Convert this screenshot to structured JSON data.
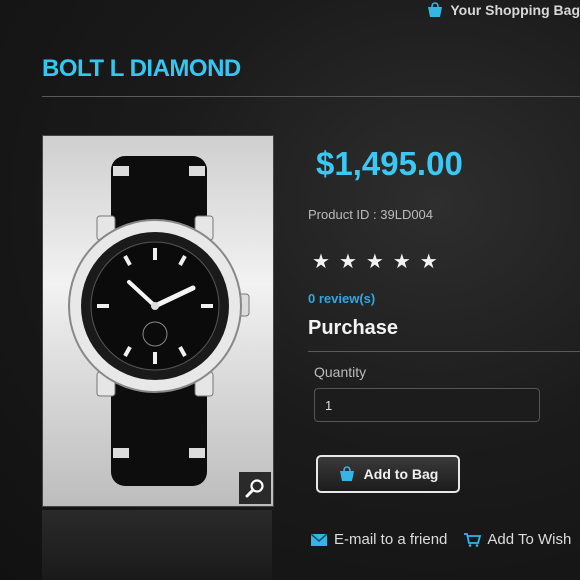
{
  "header": {
    "shopping_bag_label": "Your Shopping Bag"
  },
  "product": {
    "title": "BOLT L DIAMOND",
    "price": "$1,495.00",
    "product_id": "Product ID : 39LD004",
    "rating_stars": 5,
    "reviews_label": "0 review(s)"
  },
  "purchase": {
    "heading": "Purchase",
    "quantity_label": "Quantity",
    "quantity_value": "1",
    "add_to_bag_label": "Add to Bag"
  },
  "actions": {
    "email_friend_label": "E-mail to a friend",
    "wishlist_label": "Add To Wish"
  },
  "icons": {
    "bag": "shopping-bag-icon",
    "zoom": "magnifier-icon",
    "email": "envelope-icon",
    "wishlist": "cart-icon",
    "star": "star-icon"
  },
  "colors": {
    "accent": "#36c6f2",
    "link": "#2fa7e6",
    "background": "#1b1b1b"
  }
}
